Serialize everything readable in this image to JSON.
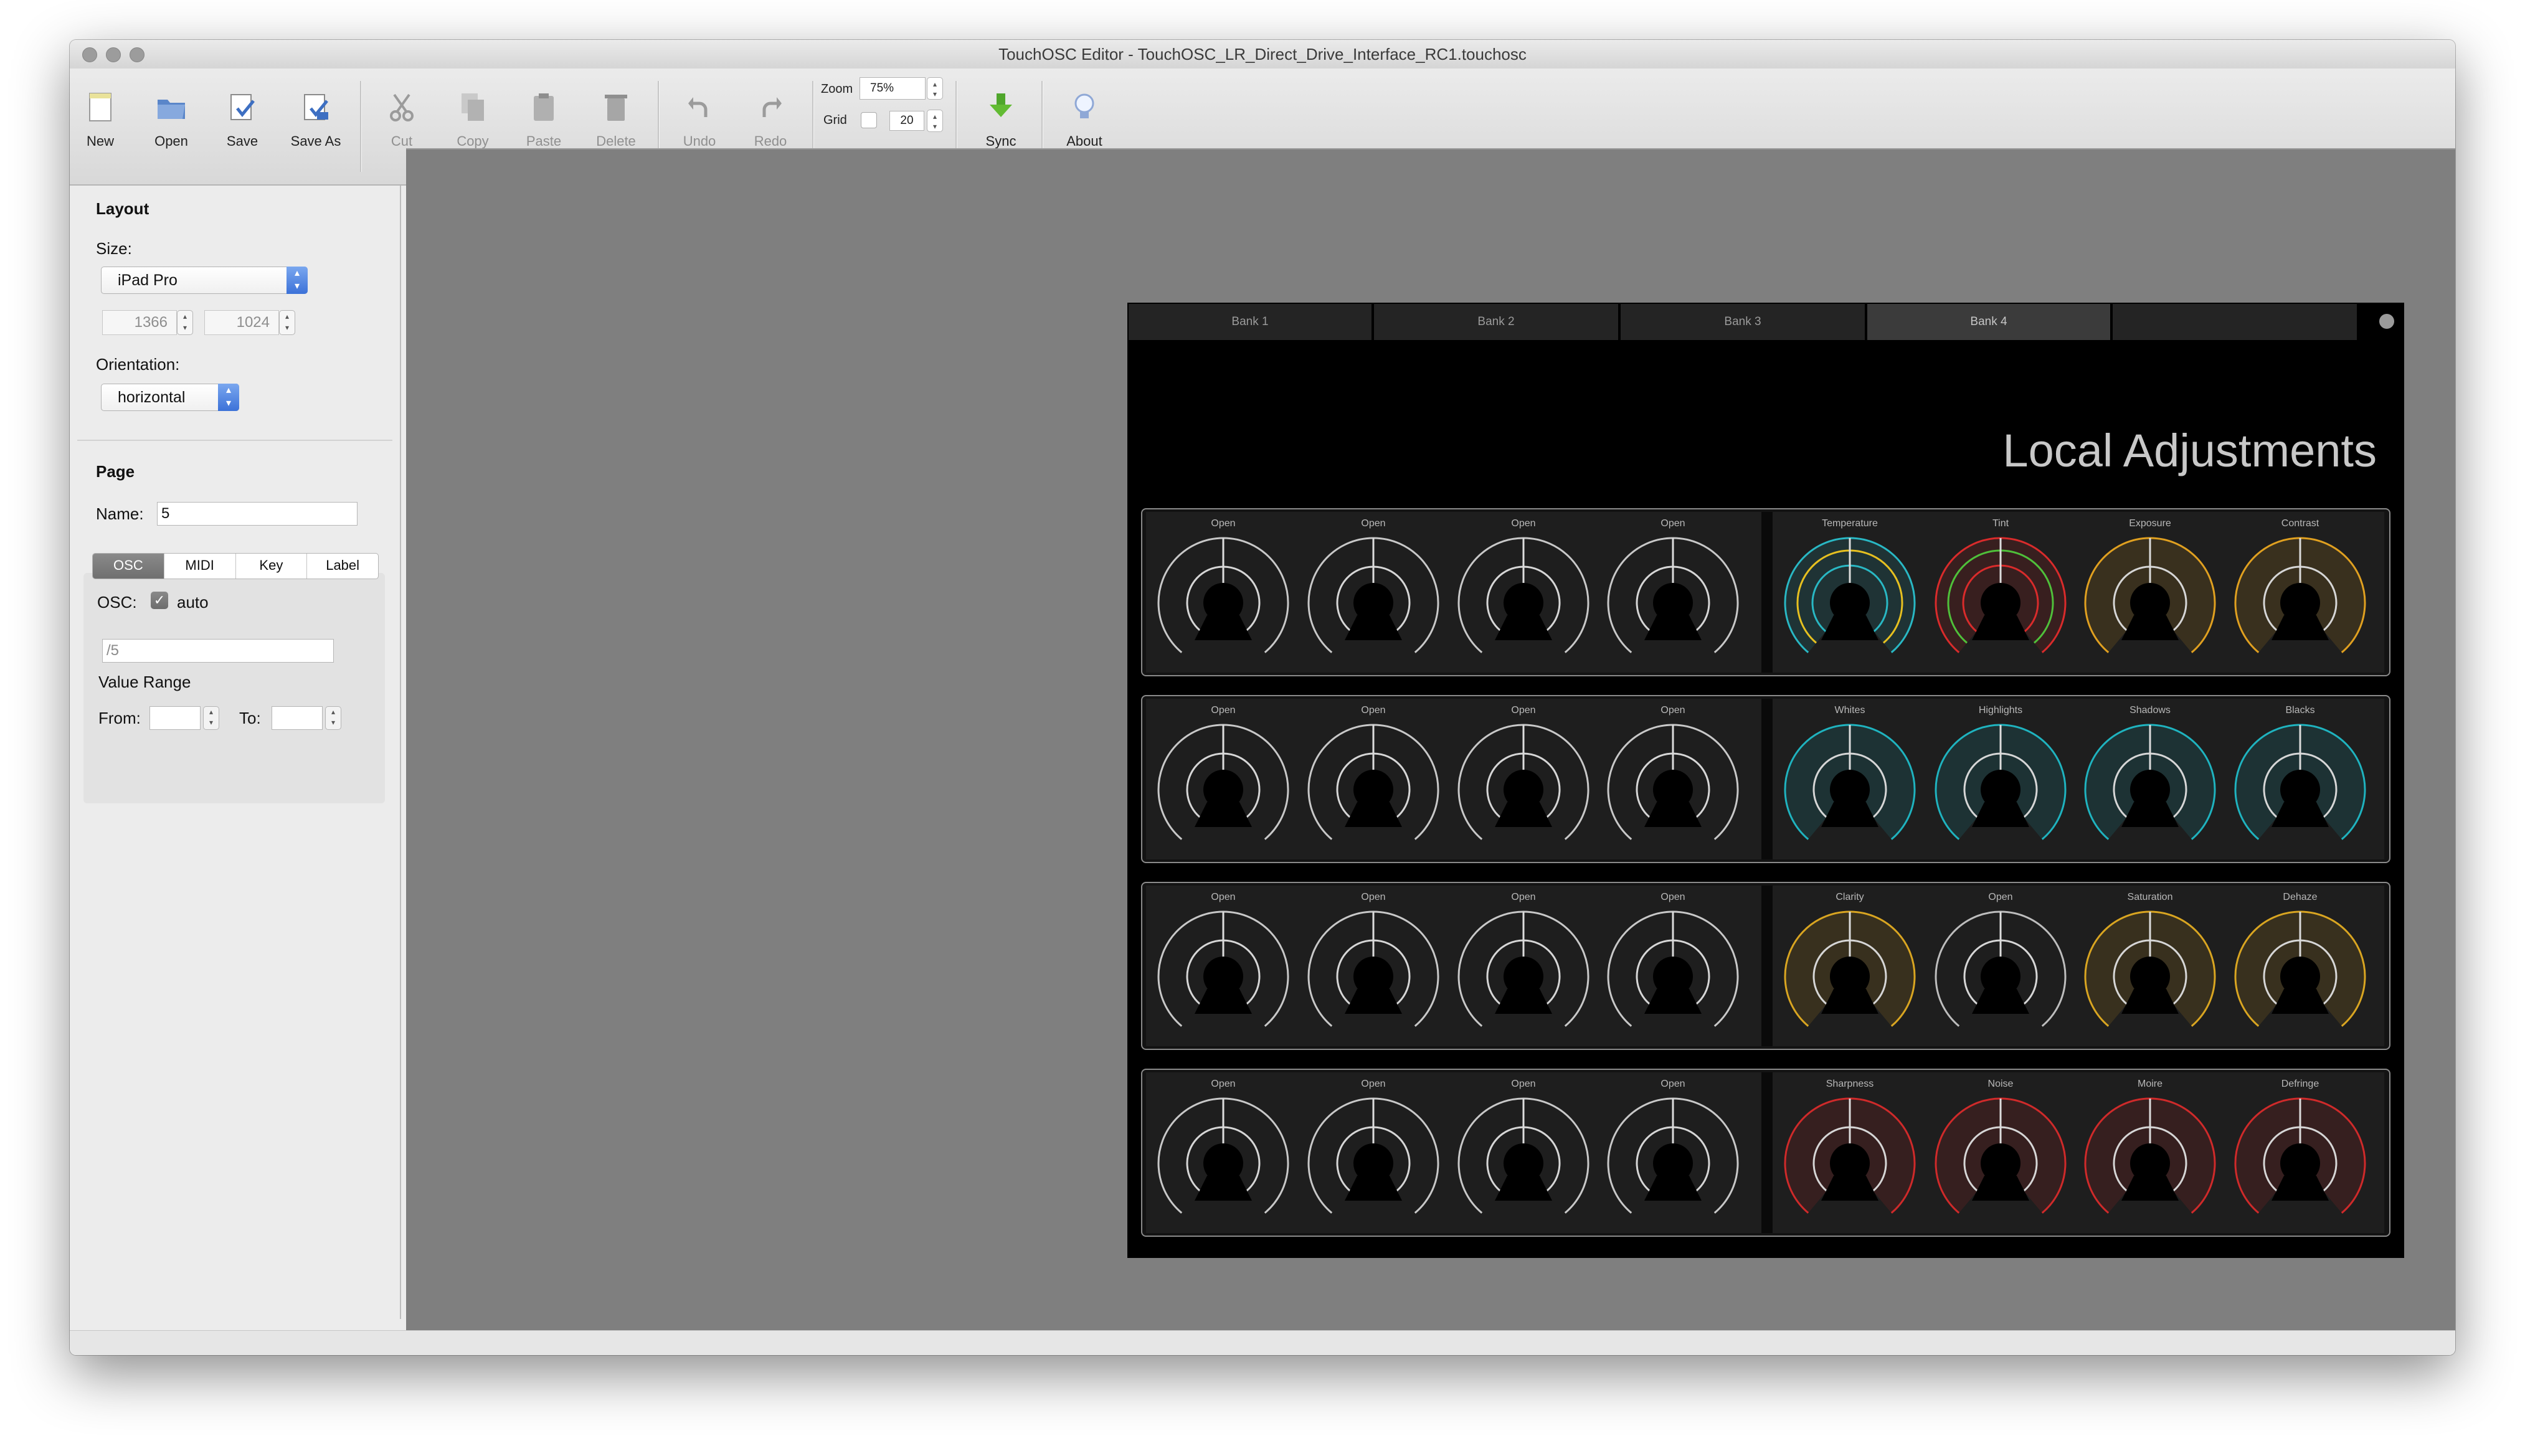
{
  "window": {
    "title": "TouchOSC Editor - TouchOSC_LR_Direct_Drive_Interface_RC1.touchosc"
  },
  "toolbar": {
    "new": "New",
    "open": "Open",
    "save": "Save",
    "save_as": "Save As",
    "cut": "Cut",
    "copy": "Copy",
    "paste": "Paste",
    "delete": "Delete",
    "undo": "Undo",
    "redo": "Redo",
    "zoom_label": "Zoom",
    "zoom_value": "75%",
    "grid_label": "Grid",
    "grid_value": "20",
    "sync": "Sync",
    "about": "About"
  },
  "sidebar": {
    "layout_heading": "Layout",
    "size_label": "Size:",
    "size_value": "iPad Pro",
    "width": "1366",
    "height": "1024",
    "orientation_label": "Orientation:",
    "orientation_value": "horizontal",
    "page_heading": "Page",
    "name_label": "Name:",
    "name_value": "5",
    "tabs": [
      "OSC",
      "MIDI",
      "Key",
      "Label"
    ],
    "osc_label": "OSC:",
    "auto_label": "auto",
    "osc_address": "/5",
    "value_range_label": "Value Range",
    "from_label": "From:",
    "to_label": "To:"
  },
  "device": {
    "tabs": [
      "Bank 1",
      "Bank 2",
      "Bank 3",
      "Bank 4"
    ],
    "page_title": "Local Adjustments",
    "rows": [
      {
        "left": [
          "Open",
          "Open",
          "Open",
          "Open"
        ],
        "right": [
          "Temperature",
          "Tint",
          "Exposure",
          "Contrast"
        ],
        "right_colors": [
          [
            "#29b8c4",
            "#e6c020"
          ],
          [
            "#d92b2b",
            "#4fc03a"
          ],
          [
            "#e0a020"
          ],
          [
            "#e0a020"
          ]
        ]
      },
      {
        "left": [
          "Open",
          "Open",
          "Open",
          "Open"
        ],
        "right": [
          "Whites",
          "Highlights",
          "Shadows",
          "Blacks"
        ],
        "right_colors": [
          [
            "#1fb3bf"
          ],
          [
            "#1fb3bf"
          ],
          [
            "#1fb3bf"
          ],
          [
            "#1fb3bf"
          ]
        ]
      },
      {
        "left": [
          "Open",
          "Open",
          "Open",
          "Open"
        ],
        "right": [
          "Clarity",
          "Open",
          "Saturation",
          "Dehaze"
        ],
        "right_colors": [
          [
            "#d9a521"
          ],
          [
            "#bdbdbd"
          ],
          [
            "#d9a521"
          ],
          [
            "#d9a521"
          ]
        ]
      },
      {
        "left": [
          "Open",
          "Open",
          "Open",
          "Open"
        ],
        "right": [
          "Sharpness",
          "Noise",
          "Moire",
          "Defringe"
        ],
        "right_colors": [
          [
            "#cf2a2a"
          ],
          [
            "#cf2a2a"
          ],
          [
            "#cf2a2a"
          ],
          [
            "#cf2a2a"
          ]
        ]
      }
    ]
  }
}
